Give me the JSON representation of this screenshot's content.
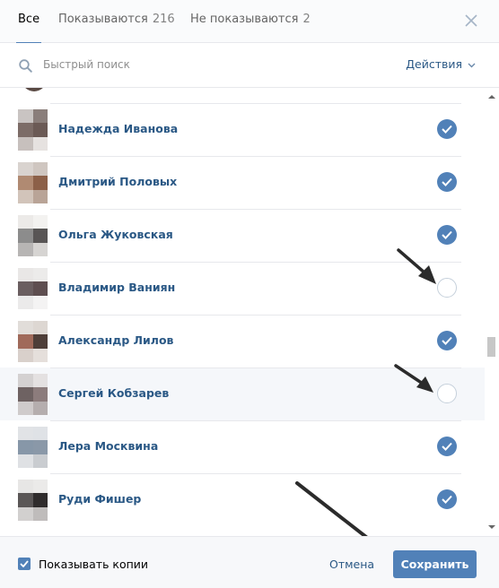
{
  "tabs": [
    {
      "label": "Все",
      "count": ""
    },
    {
      "label": "Показываются",
      "count": "216"
    },
    {
      "label": "Не показываются",
      "count": "2"
    }
  ],
  "search": {
    "placeholder": "Быстрый поиск",
    "actions_label": "Действия"
  },
  "friends": [
    {
      "name": "Надежда Иванова",
      "shown": true,
      "avatar_colors": [
        "#c9c4c2",
        "#8a7e7a",
        "#7c6c67",
        "#6b5a55",
        "#c7c0bd",
        "#e6e2e0"
      ]
    },
    {
      "name": "Дмитрий Половых",
      "shown": true,
      "avatar_colors": [
        "#d9d3cf",
        "#cfc6c0",
        "#b08a72",
        "#8c6048",
        "#d2c4ba",
        "#b9a497"
      ]
    },
    {
      "name": "Ольга Жуковская",
      "shown": true,
      "avatar_colors": [
        "#eceae8",
        "#f3f2f0",
        "#8c8c8c",
        "#585555",
        "#b7b5b4",
        "#d6d4d2"
      ]
    },
    {
      "name": "Владимир Ваниян",
      "shown": false,
      "avatar_colors": [
        "#e9e7e6",
        "#ecebea",
        "#6a5e60",
        "#5e4e50",
        "#ebeaea",
        "#f4f3f3"
      ]
    },
    {
      "name": "Александр Лилов",
      "shown": true,
      "avatar_colors": [
        "#e1ddd9",
        "#ddd7d2",
        "#a06a5a",
        "#4e3e38",
        "#d9d0cb",
        "#e5dfdb"
      ]
    },
    {
      "name": "Сергей Кобзарев",
      "shown": false,
      "avatar_colors": [
        "#d4d1d1",
        "#e4e1e1",
        "#6e6262",
        "#8c7c7c",
        "#cfcbcb",
        "#b5aeae"
      ]
    },
    {
      "name": "Лера Москвина",
      "shown": true,
      "avatar_colors": [
        "#e1e3e6",
        "#dfe2e6",
        "#8797a8",
        "#8a98a8",
        "#dfe1e4",
        "#c9ccd0"
      ]
    },
    {
      "name": "Руди Фишер",
      "shown": true,
      "avatar_colors": [
        "#e7e6e5",
        "#ebeae9",
        "#5a5656",
        "#2f2c2c",
        "#d2d0cf",
        "#bfbcbb"
      ]
    }
  ],
  "footer": {
    "show_copies_label": "Показывать копии",
    "show_copies_checked": true,
    "cancel_label": "Отмена",
    "save_label": "Сохранить"
  },
  "colors": {
    "accent": "#5181b8",
    "link": "#2a5885",
    "arrow": "#2b2b2b"
  }
}
